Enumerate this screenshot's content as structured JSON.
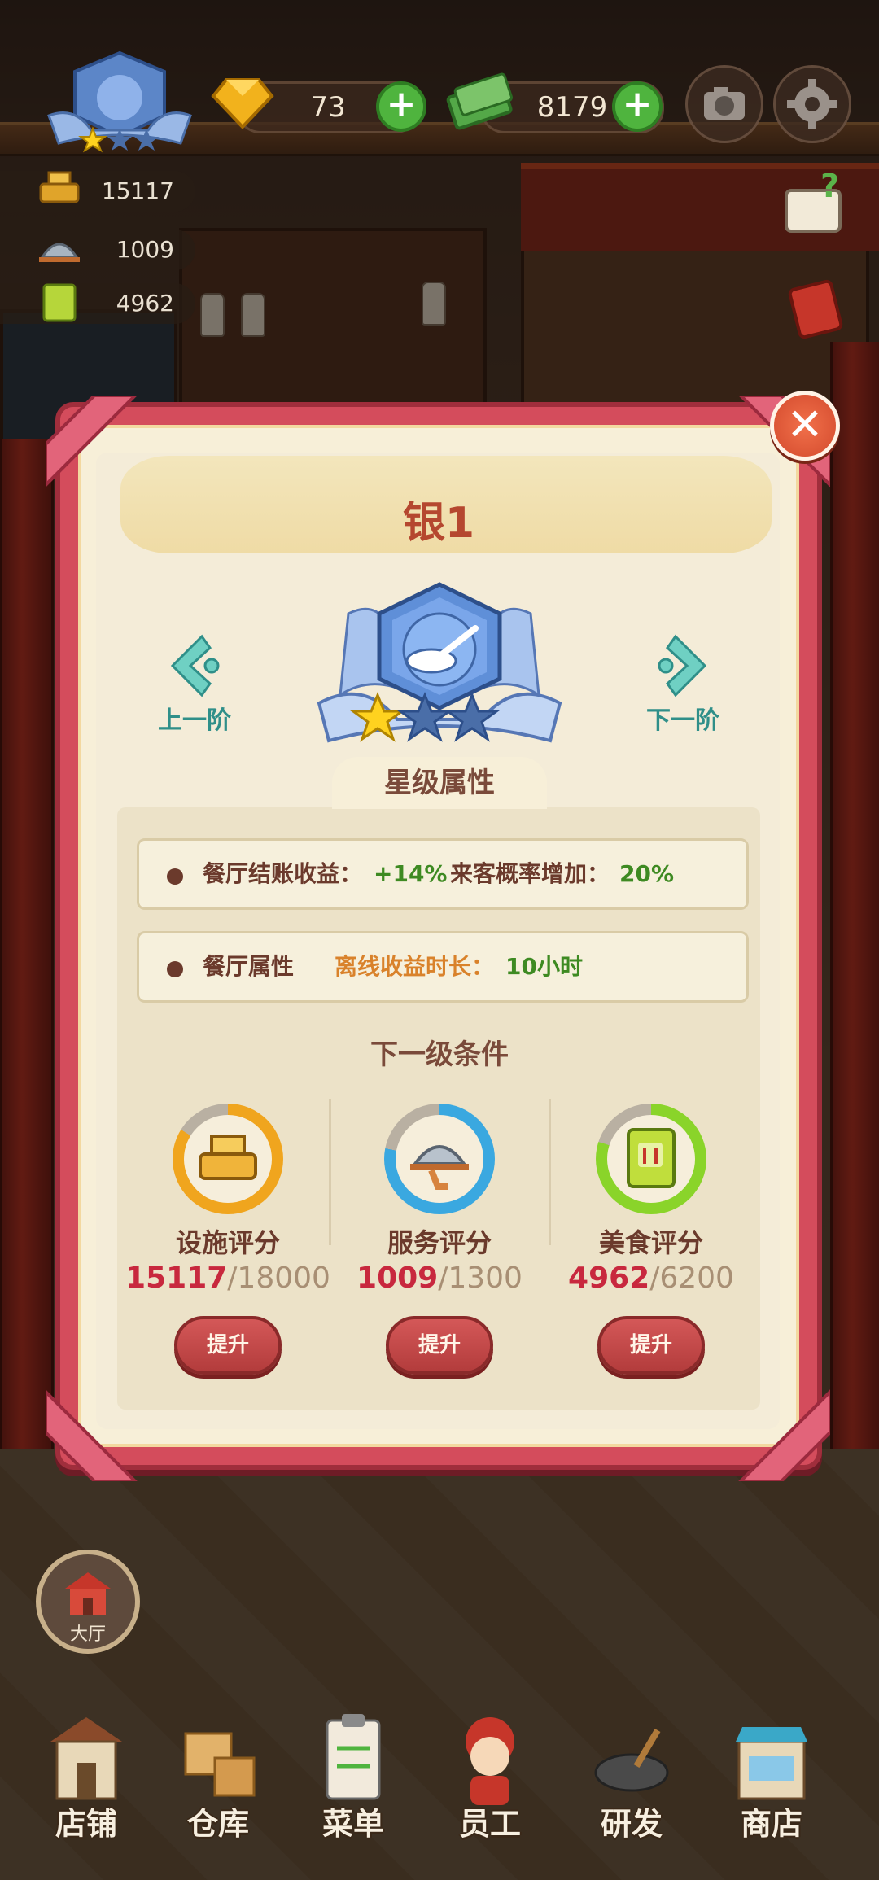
{
  "hud": {
    "gems": "73",
    "cash": "8179",
    "plus_symbol": "+",
    "facility_total": "15117",
    "service_total": "1009",
    "food_total": "4962"
  },
  "dialog": {
    "title": "银1",
    "close_symbol": "✕",
    "prev_label": "上一阶",
    "next_label": "下一阶",
    "section_title": "星级属性",
    "stars_filled": 1,
    "stars_total": 3,
    "attributes": {
      "row1_label": "餐厅结账收益：",
      "row1_value": "+14%",
      "row1_label2": "来客概率增加：",
      "row1_value2": "20%",
      "row2_label": "餐厅属性",
      "row2_label2": "离线收益时长：",
      "row2_value2": "10小时"
    },
    "next_level_title": "下一级条件",
    "scores": [
      {
        "label": "设施评分",
        "current": "15117",
        "max": "/18000",
        "progress": 0.84,
        "color": "#f0a51e",
        "button": "提升"
      },
      {
        "label": "服务评分",
        "current": "1009",
        "max": "/1300",
        "progress": 0.78,
        "color": "#3aa8e0",
        "button": "提升"
      },
      {
        "label": "美食评分",
        "current": "4962",
        "max": "/6200",
        "progress": 0.8,
        "color": "#8ad42a",
        "button": "提升"
      }
    ]
  },
  "bottom": {
    "hall_label": "大厅",
    "nav": [
      "店铺",
      "仓库",
      "菜单",
      "员工",
      "研发",
      "商店"
    ]
  }
}
